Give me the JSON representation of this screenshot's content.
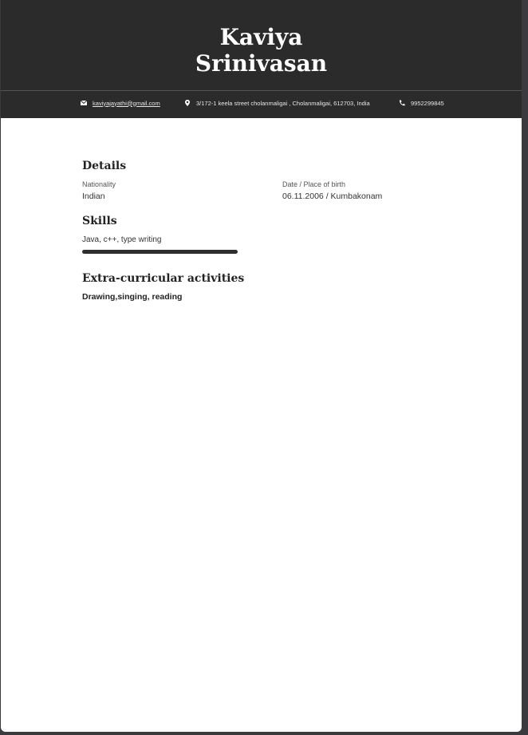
{
  "header": {
    "first_name": "Kaviya",
    "last_name": "Srinivasan",
    "email": "kaviyajayathi@gmail.com",
    "address": "3/172-1 keela street cholanmaligai , Cholanmaligai, 612703, India",
    "phone": "9952299845"
  },
  "details": {
    "title": "Details",
    "nationality_label": "Nationality",
    "nationality": "Indian",
    "birth_label": "Date / Place of birth",
    "birth": "06.11.2006 / Kumbakonam"
  },
  "skills": {
    "title": "Skills",
    "items": [
      {
        "name": "Java, c++, type writing",
        "level": 1.0
      }
    ]
  },
  "activities": {
    "title": "Extra-curricular activities",
    "text": "Drawing,singing, reading"
  },
  "icons": {
    "email": "envelope-icon",
    "address": "location-pin-icon",
    "phone": "phone-icon"
  },
  "colors": {
    "header_bg": "#2b2b2b",
    "accent": "#2e2e2e"
  }
}
